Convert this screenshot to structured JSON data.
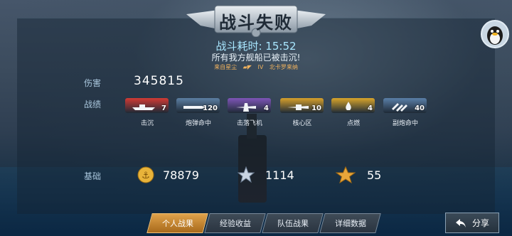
{
  "header": {
    "title": "战斗失败"
  },
  "battle": {
    "duration_label": "战斗耗时:",
    "duration_value": "15:52",
    "sunk_message": "所有我方舰船已被击沉!",
    "source_prefix": "来自星尘",
    "source_tier": "IV",
    "source_ship": "北卡罗来纳"
  },
  "stats": {
    "damage_label": "伤害",
    "damage_value": "345815",
    "record_label": "战绩",
    "base_label": "基础"
  },
  "achievements": [
    {
      "value": "7",
      "caption": "击沉",
      "color": "#d23a34",
      "icon": "ship-icon"
    },
    {
      "value": "120",
      "caption": "炮弹命中",
      "color": "#5c7fa3",
      "icon": "shell-icon"
    },
    {
      "value": "4",
      "caption": "击落飞机",
      "color": "#7f55b8",
      "icon": "plane-icon"
    },
    {
      "value": "10",
      "caption": "核心区",
      "color": "#d7a02b",
      "icon": "citadel-icon"
    },
    {
      "value": "4",
      "caption": "点燃",
      "color": "#d9a52a",
      "icon": "fire-icon"
    },
    {
      "value": "40",
      "caption": "副炮命中",
      "color": "#5a7fa8",
      "icon": "secondary-gun-icon"
    }
  ],
  "base_rewards": [
    {
      "icon": "coin-icon",
      "value": "78879"
    },
    {
      "icon": "experience-star-icon",
      "value": "1114"
    },
    {
      "icon": "captain-star-icon",
      "value": "55"
    }
  ],
  "tabs": [
    {
      "label": "个人战果",
      "active": true
    },
    {
      "label": "经验收益",
      "active": false
    },
    {
      "label": "队伍战果",
      "active": false
    },
    {
      "label": "详细数据",
      "active": false
    }
  ],
  "share_button": {
    "label": "分享"
  }
}
